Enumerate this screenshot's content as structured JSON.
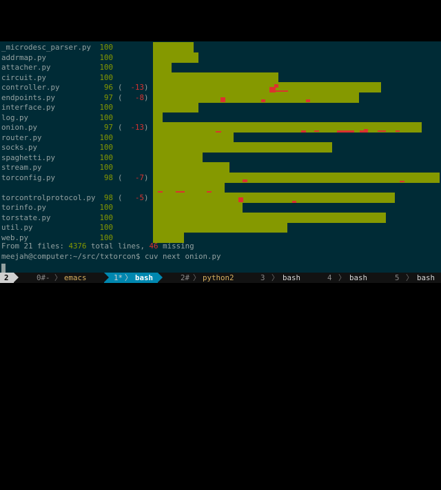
{
  "files": [
    {
      "name": "_microdesc_parser.py",
      "score": "100",
      "delta": ""
    },
    {
      "name": "addrmap.py",
      "score": "100",
      "delta": ""
    },
    {
      "name": "attacher.py",
      "score": "100",
      "delta": ""
    },
    {
      "name": "circuit.py",
      "score": "100",
      "delta": ""
    },
    {
      "name": "controller.py",
      "score": "96",
      "delta": "-13"
    },
    {
      "name": "endpoints.py",
      "score": "97",
      "delta": "-8"
    },
    {
      "name": "interface.py",
      "score": "100",
      "delta": ""
    },
    {
      "name": "log.py",
      "score": "100",
      "delta": ""
    },
    {
      "name": "onion.py",
      "score": "97",
      "delta": "-13"
    },
    {
      "name": "router.py",
      "score": "100",
      "delta": ""
    },
    {
      "name": "socks.py",
      "score": "100",
      "delta": ""
    },
    {
      "name": "spaghetti.py",
      "score": "100",
      "delta": ""
    },
    {
      "name": "stream.py",
      "score": "100",
      "delta": ""
    },
    {
      "name": "torconfig.py",
      "score": "98",
      "delta": "-7"
    },
    null,
    {
      "name": "torcontrolprotocol.py",
      "score": "98",
      "delta": "-5"
    },
    {
      "name": "torinfo.py",
      "score": "100",
      "delta": ""
    },
    {
      "name": "torstate.py",
      "score": "100",
      "delta": ""
    },
    {
      "name": "util.py",
      "score": "100",
      "delta": ""
    },
    {
      "name": "web.py",
      "score": "100",
      "delta": ""
    }
  ],
  "summary": {
    "prefix": "From 21 files: ",
    "total": "4376",
    "middle": " total lines, ",
    "missing": "46",
    "suffix": " missing"
  },
  "prompt": "meejah@computer:~/src/txtorcon$ cuv next onion.py",
  "tmux": {
    "session": "2",
    "windows": [
      {
        "index": "0#-",
        "name": "emacs"
      },
      {
        "index": "1*",
        "name": "bash",
        "active": true
      },
      {
        "index": "2#",
        "name": "python2"
      },
      {
        "index": "3",
        "name": "bash"
      },
      {
        "index": "4",
        "name": "bash"
      },
      {
        "index": "5",
        "name": "bash"
      }
    ]
  },
  "colors": {
    "background": "#002b36",
    "bar": "#859900",
    "missing": "#dc322f",
    "active_tab": "#0087af"
  }
}
